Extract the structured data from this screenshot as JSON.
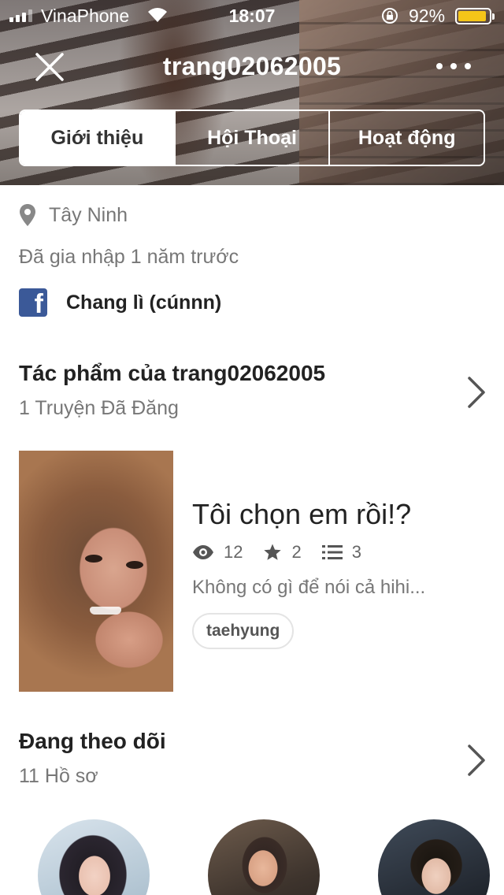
{
  "status_bar": {
    "carrier": "VinaPhone",
    "time": "18:07",
    "battery_percent": "92%",
    "battery_level": 0.92
  },
  "nav": {
    "title": "trang02062005",
    "close_icon": "close-icon",
    "more_icon": "more-horizontal-icon"
  },
  "tabs": [
    {
      "label": "Giới thiệu",
      "active": true
    },
    {
      "label": "Hội Thoại",
      "active": false
    },
    {
      "label": "Hoạt động",
      "active": false
    }
  ],
  "profile": {
    "location": "Tây Ninh",
    "joined": "Đã gia nhập 1 năm trước",
    "facebook_name": "Chang lì (cúnnn)"
  },
  "works": {
    "title": "Tác phẩm của trang02062005",
    "count": "1 Truyện Đã Đăng",
    "story": {
      "title": "Tôi chọn em rồi!?",
      "reads": "12",
      "votes": "2",
      "parts": "3",
      "description": "Không có gì để nói cả hihi...",
      "tag": "taehyung"
    }
  },
  "following": {
    "title": "Đang theo dõi",
    "count": "11 Hồ sơ"
  },
  "colors": {
    "facebook": "#3b5998",
    "battery": "#f5c518"
  }
}
